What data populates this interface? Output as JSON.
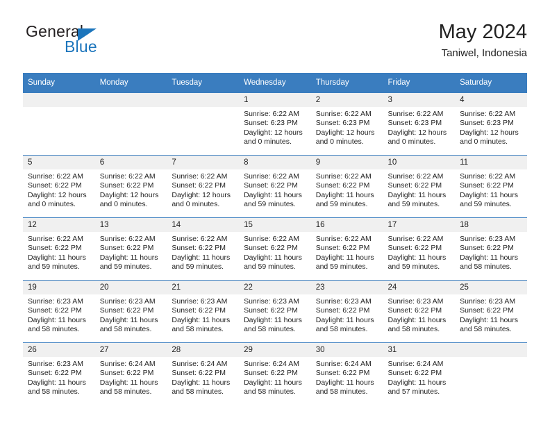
{
  "logo": {
    "word1": "General",
    "word2": "Blue",
    "triangle_color": "#1c75bc",
    "word1_color": "#231f20"
  },
  "header": {
    "title": "May 2024",
    "subtitle": "Taniwel, Indonesia"
  },
  "theme": {
    "header_blue": "#3a7dbf",
    "daynum_bg": "#f0f0f0",
    "text": "#222222"
  },
  "weekday_headers": [
    "Sunday",
    "Monday",
    "Tuesday",
    "Wednesday",
    "Thursday",
    "Friday",
    "Saturday"
  ],
  "weeks": [
    [
      {
        "day": "",
        "empty": true
      },
      {
        "day": "",
        "empty": true
      },
      {
        "day": "",
        "empty": true
      },
      {
        "day": "1",
        "sunrise": "Sunrise: 6:22 AM",
        "sunset": "Sunset: 6:23 PM",
        "daylight": "Daylight: 12 hours and 0 minutes."
      },
      {
        "day": "2",
        "sunrise": "Sunrise: 6:22 AM",
        "sunset": "Sunset: 6:23 PM",
        "daylight": "Daylight: 12 hours and 0 minutes."
      },
      {
        "day": "3",
        "sunrise": "Sunrise: 6:22 AM",
        "sunset": "Sunset: 6:23 PM",
        "daylight": "Daylight: 12 hours and 0 minutes."
      },
      {
        "day": "4",
        "sunrise": "Sunrise: 6:22 AM",
        "sunset": "Sunset: 6:23 PM",
        "daylight": "Daylight: 12 hours and 0 minutes."
      }
    ],
    [
      {
        "day": "5",
        "sunrise": "Sunrise: 6:22 AM",
        "sunset": "Sunset: 6:22 PM",
        "daylight": "Daylight: 12 hours and 0 minutes."
      },
      {
        "day": "6",
        "sunrise": "Sunrise: 6:22 AM",
        "sunset": "Sunset: 6:22 PM",
        "daylight": "Daylight: 12 hours and 0 minutes."
      },
      {
        "day": "7",
        "sunrise": "Sunrise: 6:22 AM",
        "sunset": "Sunset: 6:22 PM",
        "daylight": "Daylight: 12 hours and 0 minutes."
      },
      {
        "day": "8",
        "sunrise": "Sunrise: 6:22 AM",
        "sunset": "Sunset: 6:22 PM",
        "daylight": "Daylight: 11 hours and 59 minutes."
      },
      {
        "day": "9",
        "sunrise": "Sunrise: 6:22 AM",
        "sunset": "Sunset: 6:22 PM",
        "daylight": "Daylight: 11 hours and 59 minutes."
      },
      {
        "day": "10",
        "sunrise": "Sunrise: 6:22 AM",
        "sunset": "Sunset: 6:22 PM",
        "daylight": "Daylight: 11 hours and 59 minutes."
      },
      {
        "day": "11",
        "sunrise": "Sunrise: 6:22 AM",
        "sunset": "Sunset: 6:22 PM",
        "daylight": "Daylight: 11 hours and 59 minutes."
      }
    ],
    [
      {
        "day": "12",
        "sunrise": "Sunrise: 6:22 AM",
        "sunset": "Sunset: 6:22 PM",
        "daylight": "Daylight: 11 hours and 59 minutes."
      },
      {
        "day": "13",
        "sunrise": "Sunrise: 6:22 AM",
        "sunset": "Sunset: 6:22 PM",
        "daylight": "Daylight: 11 hours and 59 minutes."
      },
      {
        "day": "14",
        "sunrise": "Sunrise: 6:22 AM",
        "sunset": "Sunset: 6:22 PM",
        "daylight": "Daylight: 11 hours and 59 minutes."
      },
      {
        "day": "15",
        "sunrise": "Sunrise: 6:22 AM",
        "sunset": "Sunset: 6:22 PM",
        "daylight": "Daylight: 11 hours and 59 minutes."
      },
      {
        "day": "16",
        "sunrise": "Sunrise: 6:22 AM",
        "sunset": "Sunset: 6:22 PM",
        "daylight": "Daylight: 11 hours and 59 minutes."
      },
      {
        "day": "17",
        "sunrise": "Sunrise: 6:22 AM",
        "sunset": "Sunset: 6:22 PM",
        "daylight": "Daylight: 11 hours and 59 minutes."
      },
      {
        "day": "18",
        "sunrise": "Sunrise: 6:23 AM",
        "sunset": "Sunset: 6:22 PM",
        "daylight": "Daylight: 11 hours and 58 minutes."
      }
    ],
    [
      {
        "day": "19",
        "sunrise": "Sunrise: 6:23 AM",
        "sunset": "Sunset: 6:22 PM",
        "daylight": "Daylight: 11 hours and 58 minutes."
      },
      {
        "day": "20",
        "sunrise": "Sunrise: 6:23 AM",
        "sunset": "Sunset: 6:22 PM",
        "daylight": "Daylight: 11 hours and 58 minutes."
      },
      {
        "day": "21",
        "sunrise": "Sunrise: 6:23 AM",
        "sunset": "Sunset: 6:22 PM",
        "daylight": "Daylight: 11 hours and 58 minutes."
      },
      {
        "day": "22",
        "sunrise": "Sunrise: 6:23 AM",
        "sunset": "Sunset: 6:22 PM",
        "daylight": "Daylight: 11 hours and 58 minutes."
      },
      {
        "day": "23",
        "sunrise": "Sunrise: 6:23 AM",
        "sunset": "Sunset: 6:22 PM",
        "daylight": "Daylight: 11 hours and 58 minutes."
      },
      {
        "day": "24",
        "sunrise": "Sunrise: 6:23 AM",
        "sunset": "Sunset: 6:22 PM",
        "daylight": "Daylight: 11 hours and 58 minutes."
      },
      {
        "day": "25",
        "sunrise": "Sunrise: 6:23 AM",
        "sunset": "Sunset: 6:22 PM",
        "daylight": "Daylight: 11 hours and 58 minutes."
      }
    ],
    [
      {
        "day": "26",
        "sunrise": "Sunrise: 6:23 AM",
        "sunset": "Sunset: 6:22 PM",
        "daylight": "Daylight: 11 hours and 58 minutes."
      },
      {
        "day": "27",
        "sunrise": "Sunrise: 6:24 AM",
        "sunset": "Sunset: 6:22 PM",
        "daylight": "Daylight: 11 hours and 58 minutes."
      },
      {
        "day": "28",
        "sunrise": "Sunrise: 6:24 AM",
        "sunset": "Sunset: 6:22 PM",
        "daylight": "Daylight: 11 hours and 58 minutes."
      },
      {
        "day": "29",
        "sunrise": "Sunrise: 6:24 AM",
        "sunset": "Sunset: 6:22 PM",
        "daylight": "Daylight: 11 hours and 58 minutes."
      },
      {
        "day": "30",
        "sunrise": "Sunrise: 6:24 AM",
        "sunset": "Sunset: 6:22 PM",
        "daylight": "Daylight: 11 hours and 58 minutes."
      },
      {
        "day": "31",
        "sunrise": "Sunrise: 6:24 AM",
        "sunset": "Sunset: 6:22 PM",
        "daylight": "Daylight: 11 hours and 57 minutes."
      },
      {
        "day": "",
        "empty": true
      }
    ]
  ]
}
